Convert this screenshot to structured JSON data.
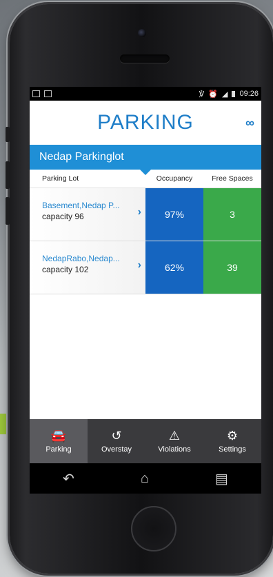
{
  "status_bar": {
    "time": "09:26"
  },
  "header": {
    "title": "PARKING",
    "logo_icon": "nedap-logo-icon"
  },
  "lot_bar": {
    "name": "Nedap Parkinglot"
  },
  "columns": {
    "lot": "Parking Lot",
    "occupancy": "Occupancy",
    "free": "Free Spaces"
  },
  "rows": [
    {
      "name": "Basement,Nedap P...",
      "capacity": "capacity 96",
      "occupancy": "97%",
      "free": "3"
    },
    {
      "name": "NedapRabo,Nedap...",
      "capacity": "capacity 102",
      "occupancy": "62%",
      "free": "39"
    }
  ],
  "tabs": [
    {
      "label": "Parking",
      "icon": "car-icon",
      "active": true
    },
    {
      "label": "Overstay",
      "icon": "history-icon",
      "active": false
    },
    {
      "label": "Violations",
      "icon": "warning-icon",
      "active": false
    },
    {
      "label": "Settings",
      "icon": "gear-icon",
      "active": false
    }
  ],
  "colors": {
    "brand_blue": "#1f7ec8",
    "occupancy_blue": "#1565c0",
    "free_green": "#3aa94a",
    "tabbar": "#3a3a3d"
  }
}
